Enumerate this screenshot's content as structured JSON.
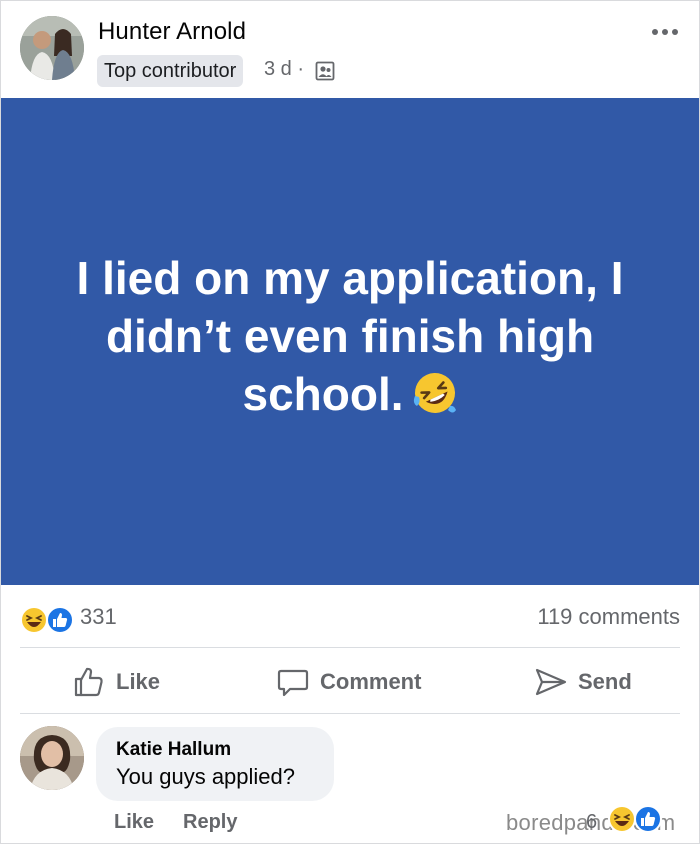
{
  "post": {
    "author": "Hunter Arnold",
    "badge": "Top contributor",
    "time": "3 d ·",
    "body": "I lied on my application, I didn’t even finish high school.",
    "reaction_count": "331",
    "comment_count": "119 comments",
    "card_color": "#3159a7"
  },
  "actions": {
    "like": "Like",
    "comment": "Comment",
    "send": "Send"
  },
  "comment": {
    "author": "Katie Hallum",
    "text": "You guys applied?",
    "like": "Like",
    "reply": "Reply",
    "reaction_count": "6"
  },
  "watermark": "boredpanda.com",
  "icons": [
    "more-icon",
    "audience-icon",
    "laugh-reaction-icon",
    "like-reaction-icon",
    "thumbs-up-icon",
    "comment-icon",
    "send-icon",
    "rolling-laughing-emoji"
  ]
}
